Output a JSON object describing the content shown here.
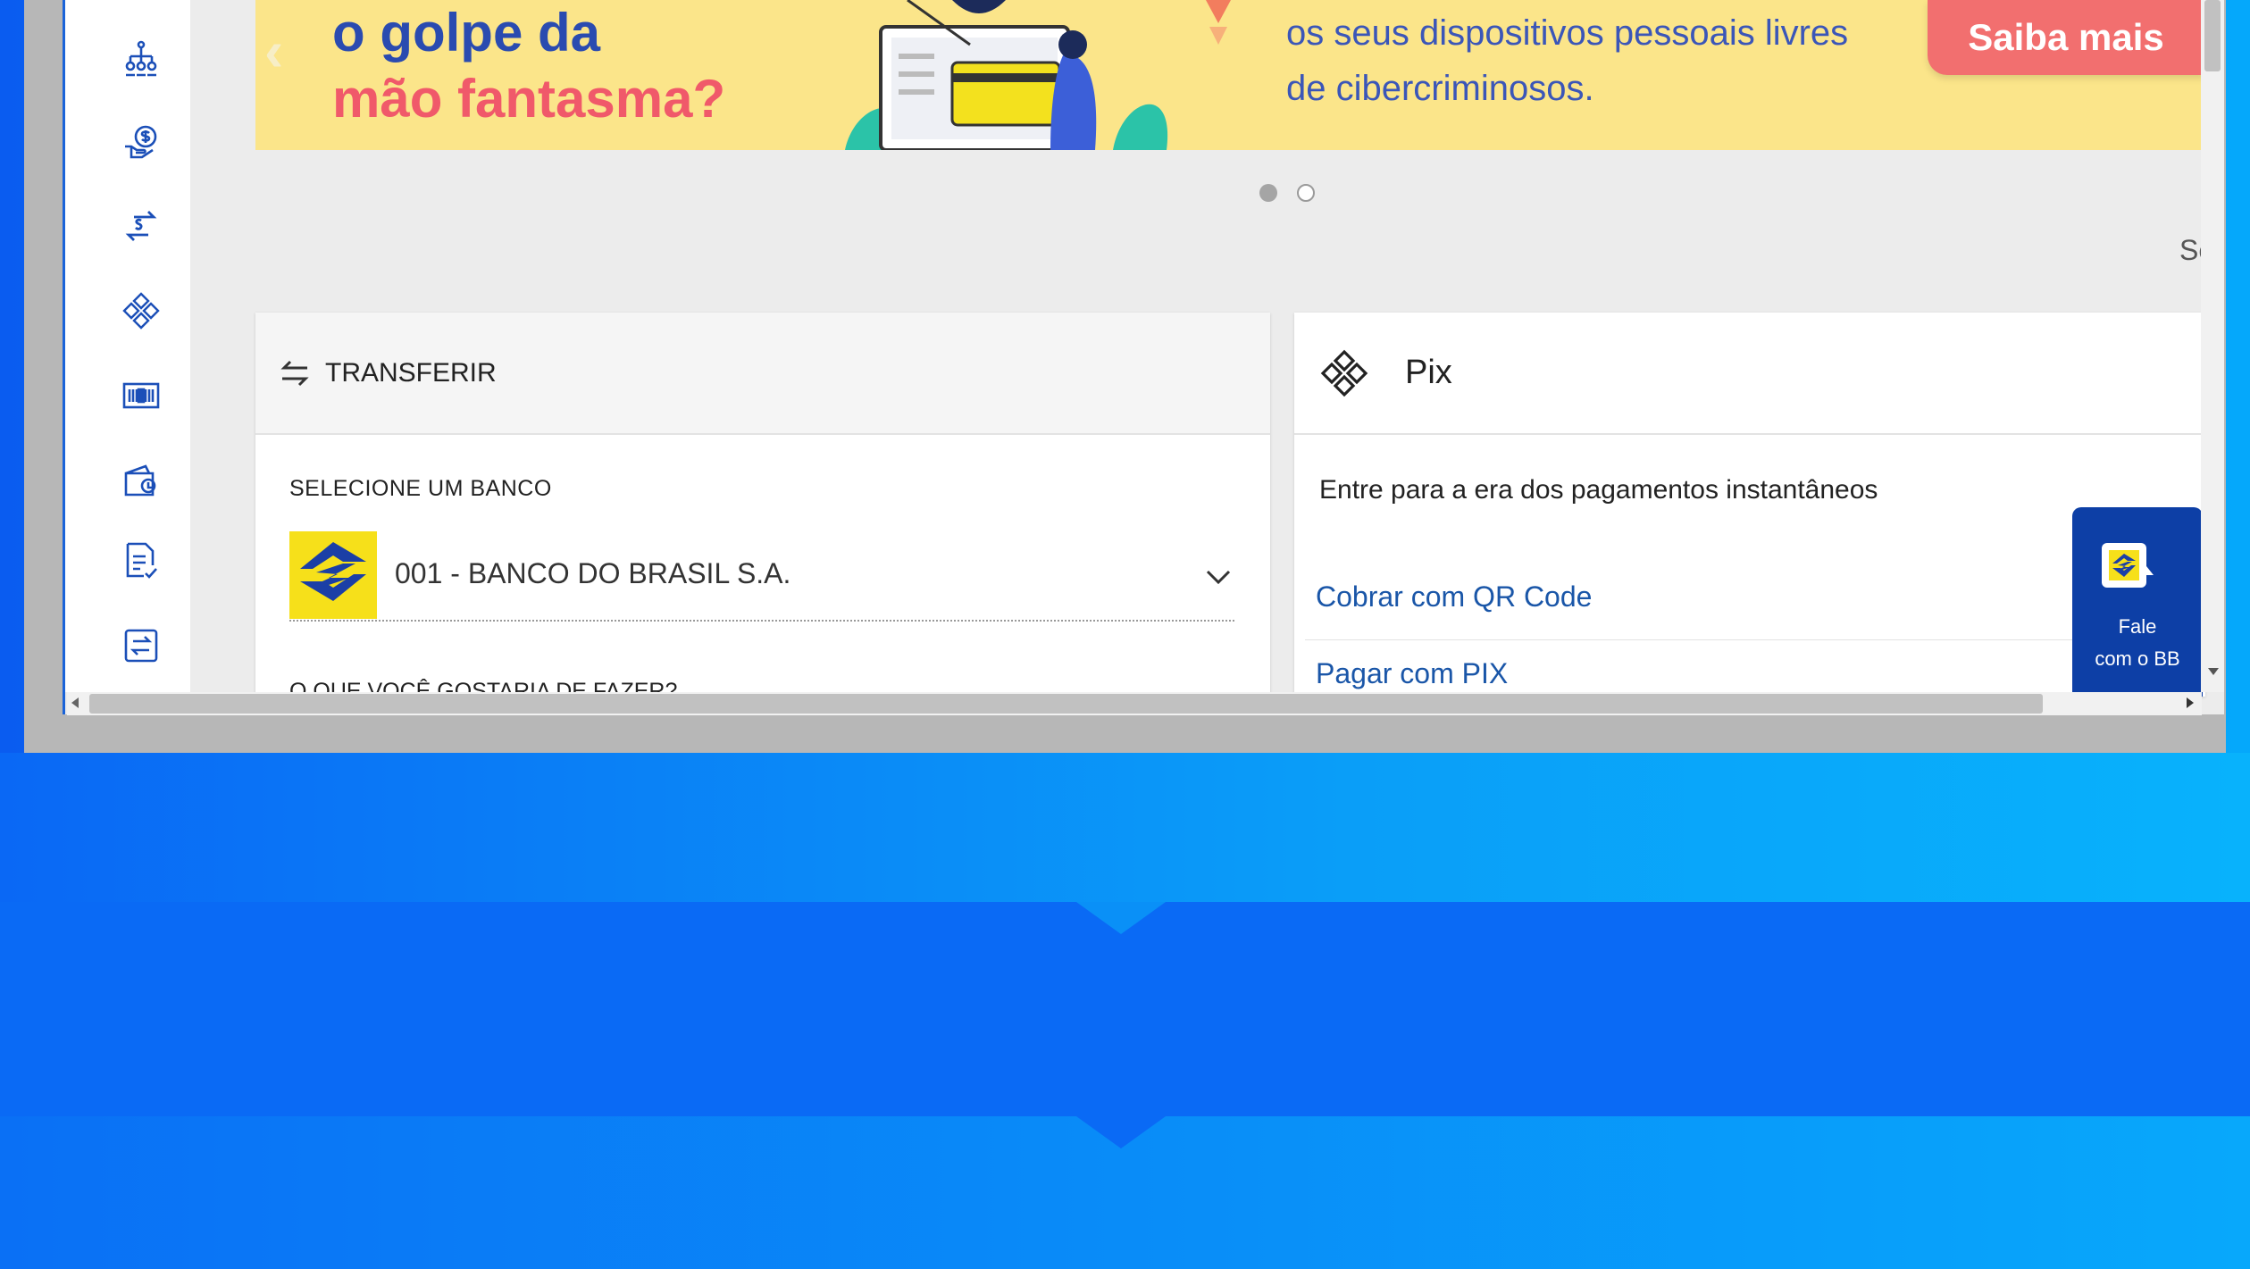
{
  "banner": {
    "headline_line1": "o golpe da",
    "headline_line2": "mão fantasma?",
    "body_line1": "os seus dispositivos pessoais livres",
    "body_line2": "de cibercriminosos.",
    "cta_label": "Saiba mais"
  },
  "carousel": {
    "slide_count": 2,
    "active_index": 0
  },
  "cut_text": "Se",
  "sidebar": {
    "icons": [
      "org-chart-icon",
      "money-hand-icon",
      "transfer-arrows-icon",
      "pix-icon",
      "boleto-icon",
      "wallet-icon",
      "document-check-icon",
      "exchange-icon"
    ]
  },
  "transfer": {
    "title": "TRANSFERIR",
    "select_bank_label": "SELECIONE UM BANCO",
    "bank_value": "001 - BANCO DO BRASIL S.A.",
    "question_label": "O QUE VOCÊ GOSTARIA DE FAZER?"
  },
  "pix": {
    "title": "Pix",
    "subtitle": "Entre para a era dos pagamentos instantâneos",
    "links": [
      "Cobrar com QR Code",
      "Pagar com PIX"
    ]
  },
  "chat": {
    "line1": "Fale",
    "line2": "com o BB"
  },
  "colors": {
    "brand_blue": "#0d3fa6",
    "brand_yellow": "#f6e01a",
    "cta_red": "#f26f6f",
    "banner_yellow": "#fbe58a",
    "link_blue": "#1a56a8"
  }
}
